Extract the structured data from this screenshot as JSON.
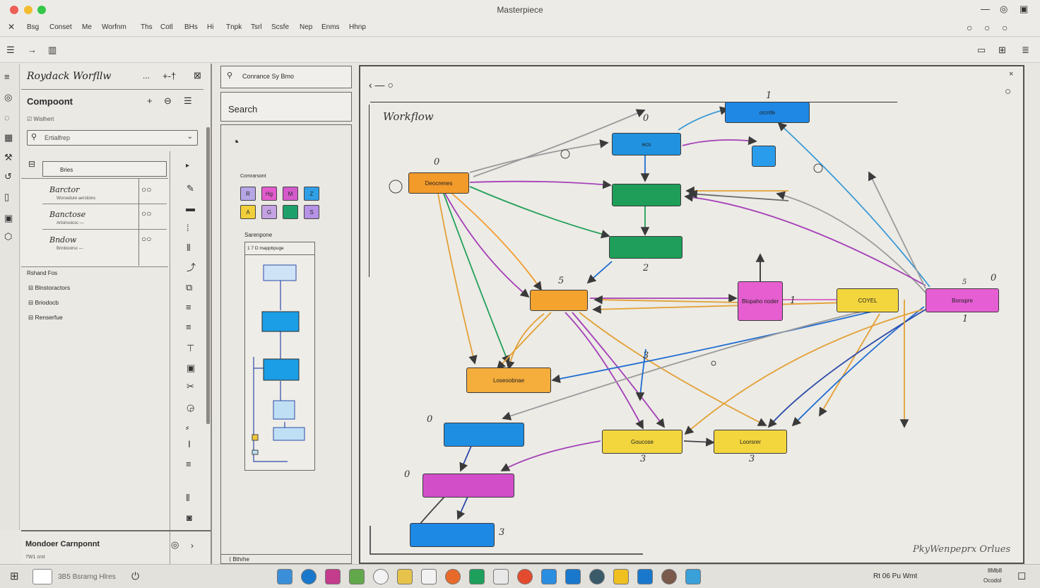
{
  "window": {
    "title": "Masterpiece",
    "controls": [
      "minimize-icon",
      "maximize-icon",
      "restore-icon"
    ]
  },
  "menu": [
    "Bsg",
    "Conset",
    "Me",
    "Worfnm",
    "Ths",
    "Cotl",
    "BHs",
    "Hi",
    "Tnpk",
    "Tsrl",
    "Scsfe",
    "Nep",
    "Enms",
    "Hhnp"
  ],
  "left_panel": {
    "header": "Roydack Worfllw",
    "header_actions": [
      "...",
      "+-†",
      "⊠"
    ],
    "section_title": "Compoont",
    "filter_label": "☑ Wislhert",
    "search_placeholder": "Ertialfrep",
    "tree_header": "Bries",
    "tree_items": [
      {
        "label": "Barctor",
        "sub": "Worsedure aerstions"
      },
      {
        "label": "Banctose",
        "sub": "Artoirsoicsc —"
      },
      {
        "label": "Bndow",
        "sub": "Brinbooirsc —"
      }
    ],
    "group_title": "Rshand Fos",
    "links": [
      "Blnstoractors",
      "Briodocb",
      "Renserfue"
    ],
    "footer_label": "Mondoer Carnponnt",
    "footer_sub": "7W1 crst"
  },
  "mid_panel": {
    "search_label": "Conrance Sy Bmo",
    "search_button": "Search",
    "palette_title": "Comrarsont",
    "palette_colors": [
      "#b6a6e6",
      "#e35bcc",
      "#d45acb",
      "#2f9fe6",
      "#f0cf3b",
      "#c4a2e2",
      "#1ea06b",
      "#b592e5"
    ],
    "palette_glyphs": [
      "R",
      "Hg",
      "M",
      "Z",
      "A",
      "G",
      "",
      "S"
    ],
    "mini_title": "Sarenpone",
    "mini_header": "1 7 D mappbpuge",
    "footer": "Bthrhe"
  },
  "canvas": {
    "label": "Workflow",
    "signature": "PkyWenpeprx Orlues",
    "numbers": [
      "0",
      "0",
      "1",
      "5",
      "2",
      "1",
      "3",
      "1",
      "0",
      "3",
      "3",
      "3",
      "0",
      "0",
      "5"
    ],
    "nodes": [
      {
        "text": "Deocrenes",
        "color": "#f29a2a"
      },
      {
        "text": "ecs",
        "color": "#2192df"
      },
      {
        "text": "ocrnfe",
        "color": "#1f88e5"
      },
      {
        "text": "",
        "color": "#2a9cec"
      },
      {
        "text": "",
        "color": "#1e9e58"
      },
      {
        "text": "",
        "color": "#1e9e5a"
      },
      {
        "text": "",
        "color": "#f4a32f"
      },
      {
        "text": "Blopaho noder",
        "color": "#e65ed0"
      },
      {
        "text": "COYEL",
        "color": "#f3d63e"
      },
      {
        "text": "Bonspre",
        "color": "#e65ed4"
      },
      {
        "text": "Loseoobnae",
        "color": "#f5ad3c"
      },
      {
        "text": "",
        "color": "#1e8ee3"
      },
      {
        "text": "Goucose",
        "color": "#f3d63e"
      },
      {
        "text": "Loorsrer",
        "color": "#f3d63e"
      },
      {
        "text": "",
        "color": "#d24ec9"
      },
      {
        "text": "",
        "color": "#1e88e5"
      }
    ]
  },
  "taskbar": {
    "search_text": "3B5 Bsrarng Hlres",
    "tray_text": "Rt 06 Pu Wmt",
    "time": "8Mb8",
    "date": "Ocodol",
    "app_colors": [
      "#3b8fd8",
      "#1a78cc",
      "#c43c8c",
      "#62a84a",
      "#f2f2f2",
      "#e6c34a",
      "#f2f2f2",
      "#e86a2a",
      "#1ea05c",
      "#e8e8e8",
      "#e34a2e",
      "#2a8de0",
      "#1a78cc",
      "#3a5a6a",
      "#f0c020",
      "#1a78cc",
      "#7a5a4a",
      "#3aa0d8"
    ]
  }
}
